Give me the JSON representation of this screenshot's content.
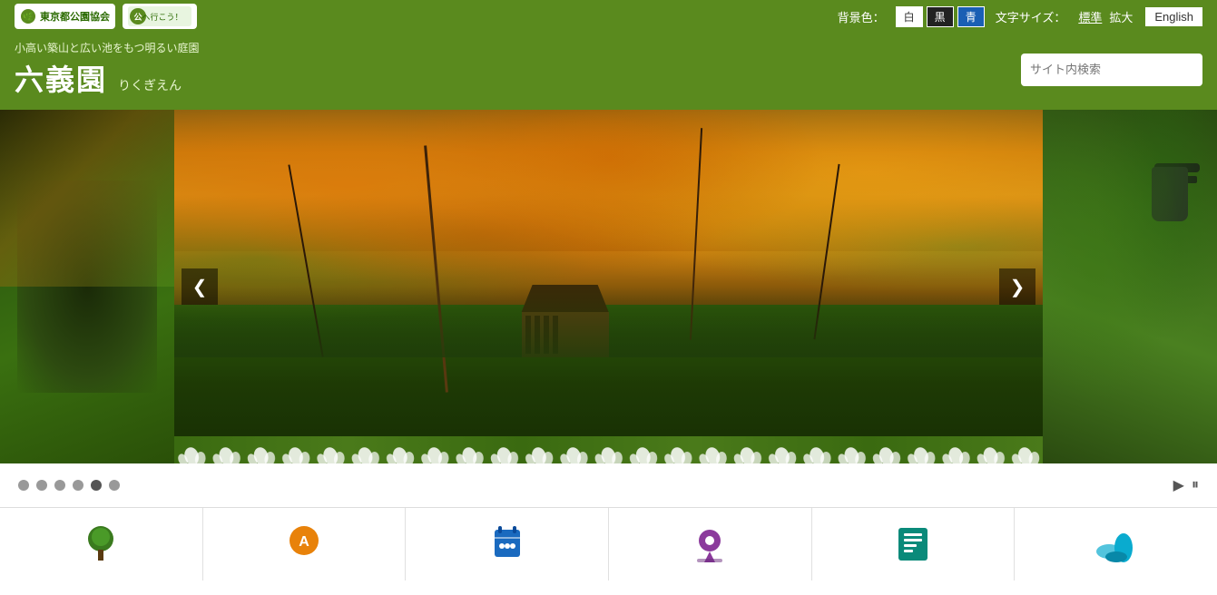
{
  "header": {
    "logos": {
      "tpa_label": "東京都公園協会",
      "kouai_label": "公園へ行こう！"
    },
    "controls": {
      "bg_color_label": "背景色：",
      "bg_white": "白",
      "bg_black": "黒",
      "bg_blue": "青",
      "font_size_label": "文字サイズ：",
      "font_standard": "標準",
      "font_large": "拡大",
      "english_label": "English"
    },
    "site": {
      "subtitle": "小高い築山と広い池をもつ明るい庭園",
      "title": "六義園",
      "reading": "りくぎえん"
    },
    "search": {
      "placeholder": "サイト内検索"
    }
  },
  "carousel": {
    "prev_label": "❮",
    "next_label": "❯",
    "dots": [
      {
        "index": 0,
        "active": false
      },
      {
        "index": 1,
        "active": false
      },
      {
        "index": 2,
        "active": false
      },
      {
        "index": 3,
        "active": false
      },
      {
        "index": 4,
        "active": true
      },
      {
        "index": 5,
        "active": false
      }
    ],
    "play_label": "▶",
    "pause_label": "⏸"
  },
  "icon_nav": {
    "items": [
      {
        "id": "about",
        "icon": "🌳",
        "label": "",
        "color": "green"
      },
      {
        "id": "access",
        "icon": "🅿",
        "label": "",
        "color": "orange"
      },
      {
        "id": "events",
        "icon": "🔒",
        "label": "",
        "color": "blue"
      },
      {
        "id": "map",
        "icon": "📍",
        "label": "",
        "color": "purple"
      },
      {
        "id": "info",
        "icon": "📋",
        "label": "",
        "color": "teal"
      },
      {
        "id": "gallery",
        "icon": "🌊",
        "label": "",
        "color": "cyan"
      }
    ]
  }
}
